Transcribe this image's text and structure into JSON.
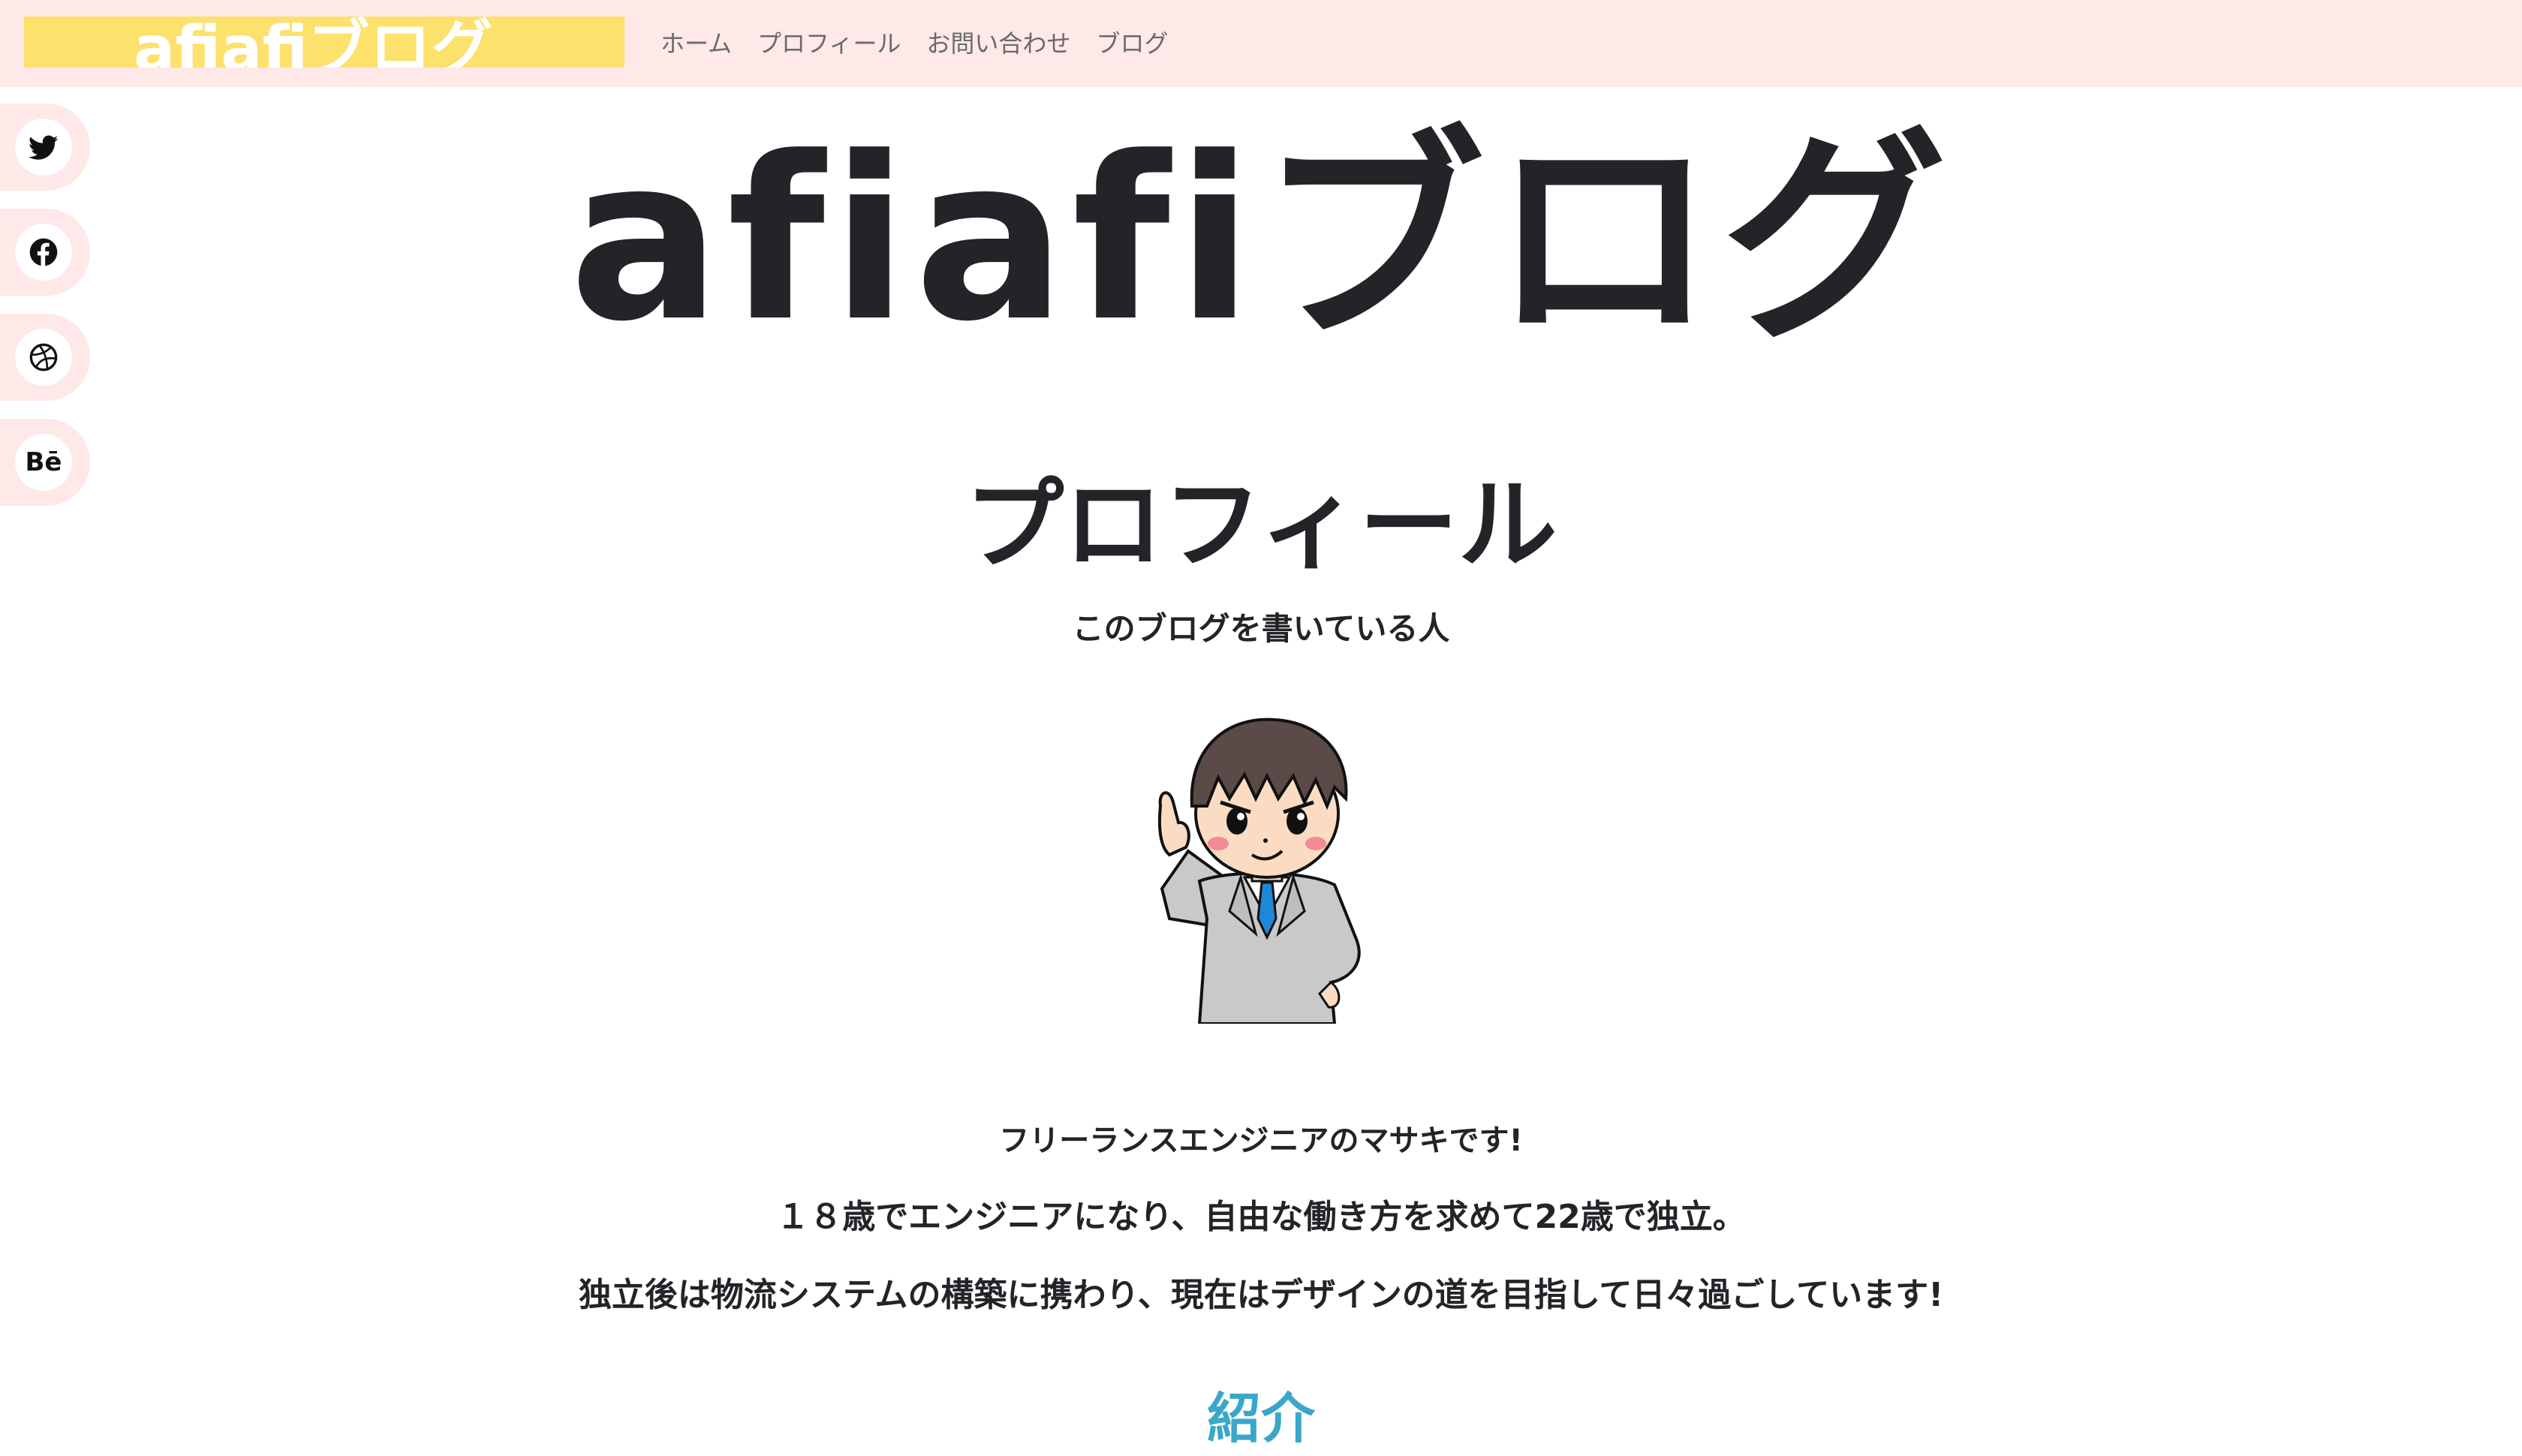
{
  "header": {
    "logo_text": "afiafiブログ",
    "nav": [
      "ホーム",
      "プロフィール",
      "お問い合わせ",
      "ブログ"
    ]
  },
  "social": {
    "icons": [
      "twitter-icon",
      "facebook-icon",
      "dribbble-icon",
      "behance-icon"
    ],
    "behance_label": "Bē"
  },
  "hero": {
    "title": "afiafiブログ"
  },
  "profile": {
    "heading": "プロフィール",
    "subheading": "このブログを書いている人",
    "avatar": "avatar-illustration",
    "lines": [
      "フリーランスエンジニアのマサキです!",
      "１８歳でエンジニアになり、自由な働き方を求めて22歳で独立。",
      "独立後は物流システムの構築に携わり、現在はデザインの道を目指して日々過ごしています!"
    ]
  },
  "next_section": {
    "heading": "紹介"
  },
  "colors": {
    "topbar_bg": "#fee8e8",
    "logo_bg": "#fde16d",
    "text": "#222428",
    "accent": "#3aa7c9"
  }
}
